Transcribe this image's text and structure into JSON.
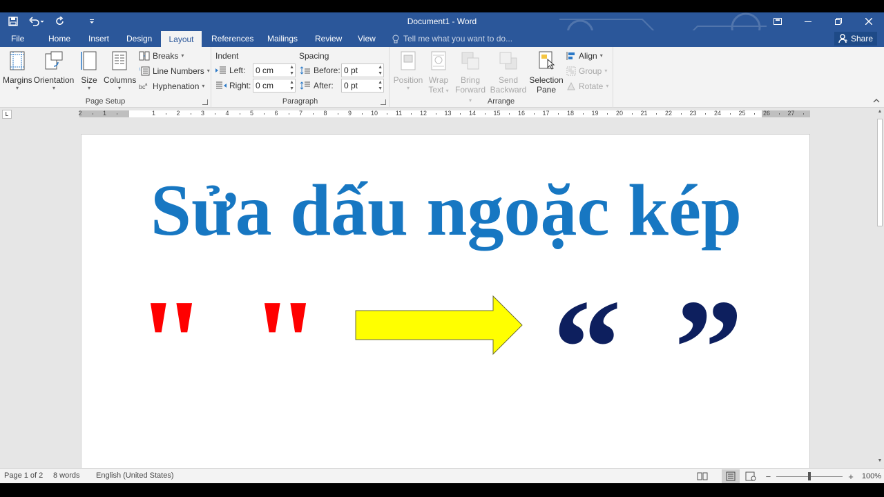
{
  "titlebar": {
    "title": "Document1 - Word",
    "minimize_icon": "ribbon-display-icon",
    "restore_icon": "restore-icon",
    "close_icon": "close-icon"
  },
  "tabs": [
    "File",
    "Home",
    "Insert",
    "Design",
    "Layout",
    "References",
    "Mailings",
    "Review",
    "View"
  ],
  "active_tab": "Layout",
  "tellme": "Tell me what you want to do...",
  "share": "Share",
  "ribbon": {
    "page_setup": {
      "label": "Page Setup",
      "margins": "Margins",
      "orientation": "Orientation",
      "size": "Size",
      "columns": "Columns",
      "breaks": "Breaks",
      "line_numbers": "Line Numbers",
      "hyphenation": "Hyphenation"
    },
    "paragraph": {
      "label": "Paragraph",
      "indent": "Indent",
      "spacing": "Spacing",
      "left_label": "Left:",
      "left_value": "0 cm",
      "right_label": "Right:",
      "right_value": "0 cm",
      "before_label": "Before:",
      "before_value": "0 pt",
      "after_label": "After:",
      "after_value": "0 pt"
    },
    "arrange": {
      "label": "Arrange",
      "position": "Position",
      "wrap_1": "Wrap",
      "wrap_2": "Text",
      "bring_1": "Bring",
      "bring_2": "Forward",
      "send_1": "Send",
      "send_2": "Backward",
      "sel_1": "Selection",
      "sel_2": "Pane",
      "align": "Align",
      "group": "Group",
      "rotate": "Rotate"
    }
  },
  "ruler_numbers": [
    "2",
    "1",
    "1",
    "2",
    "3",
    "4",
    "5",
    "6",
    "7",
    "8",
    "9",
    "10",
    "11",
    "12",
    "13",
    "14",
    "15",
    "16",
    "17",
    "18",
    "19",
    "20",
    "21",
    "22",
    "23",
    "24",
    "25",
    "26",
    "27"
  ],
  "document": {
    "heading": "Sửa dấu ngoặc kép",
    "straight_left": "\"",
    "straight_right": "\"",
    "curly_open": "“",
    "curly_close": "”",
    "arrow_color": "#ffff00",
    "straight_color": "#ff0000",
    "curly_color": "#0d1f5e",
    "heading_color": "#1777c2"
  },
  "status": {
    "page": "Page 1 of 2",
    "words": "8 words",
    "language": "English (United States)",
    "zoom": "100%",
    "zoom_level": 1.0
  }
}
